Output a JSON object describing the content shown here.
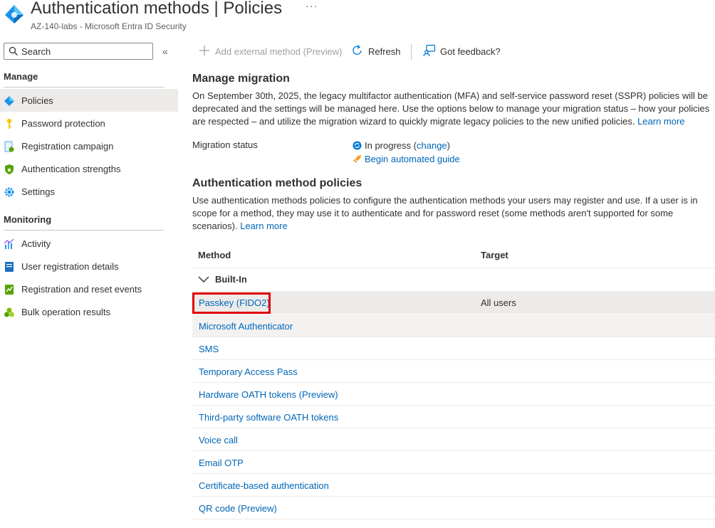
{
  "header": {
    "title_main": "Authentication methods",
    "title_sep": " | ",
    "title_page": "Policies",
    "more": "···",
    "subtitle": "AZ-140-labs - Microsoft Entra ID Security"
  },
  "sidebar": {
    "search_placeholder": "Search",
    "collapse": "«",
    "manage_heading": "Manage",
    "manage_items": [
      {
        "label": "Policies",
        "icon": "policies-icon",
        "active": true
      },
      {
        "label": "Password protection",
        "icon": "key-icon"
      },
      {
        "label": "Registration campaign",
        "icon": "campaign-icon"
      },
      {
        "label": "Authentication strengths",
        "icon": "shield-icon"
      },
      {
        "label": "Settings",
        "icon": "gear-icon"
      }
    ],
    "monitoring_heading": "Monitoring",
    "monitoring_items": [
      {
        "label": "Activity",
        "icon": "chart-icon"
      },
      {
        "label": "User registration details",
        "icon": "details-icon"
      },
      {
        "label": "Registration and reset events",
        "icon": "events-icon"
      },
      {
        "label": "Bulk operation results",
        "icon": "bulk-icon"
      }
    ]
  },
  "toolbar": {
    "add_external": "Add external method (Preview)",
    "refresh": "Refresh",
    "feedback": "Got feedback?"
  },
  "migration": {
    "heading": "Manage migration",
    "body": "On September 30th, 2025, the legacy multifactor authentication (MFA) and self-service password reset (SSPR) policies will be deprecated and the settings will be managed here. Use the options below to manage your migration status – how your policies are respected – and utilize the migration wizard to quickly migrate legacy policies to the new unified policies.",
    "learn_more": "Learn more",
    "status_label": "Migration status",
    "status_value": "In progress",
    "change": "change",
    "guide": "Begin automated guide"
  },
  "policies": {
    "heading": "Authentication method policies",
    "body": "Use authentication methods policies to configure the authentication methods your users may register and use. If a user is in scope for a method, they may use it to authenticate and for password reset (some methods aren't supported for some scenarios).",
    "learn_more": "Learn more",
    "col_method": "Method",
    "col_target": "Target",
    "group": "Built-In",
    "rows": [
      {
        "method": "Passkey (FIDO2)",
        "target": "All users"
      },
      {
        "method": "Microsoft Authenticator",
        "target": ""
      },
      {
        "method": "SMS",
        "target": ""
      },
      {
        "method": "Temporary Access Pass",
        "target": ""
      },
      {
        "method": "Hardware OATH tokens (Preview)",
        "target": ""
      },
      {
        "method": "Third-party software OATH tokens",
        "target": ""
      },
      {
        "method": "Voice call",
        "target": ""
      },
      {
        "method": "Email OTP",
        "target": ""
      },
      {
        "method": "Certificate-based authentication",
        "target": ""
      },
      {
        "method": "QR code (Preview)",
        "target": ""
      }
    ]
  },
  "colors": {
    "link": "#0066b8",
    "highlight_box": "#e00000",
    "active_bg": "#edebe9"
  }
}
